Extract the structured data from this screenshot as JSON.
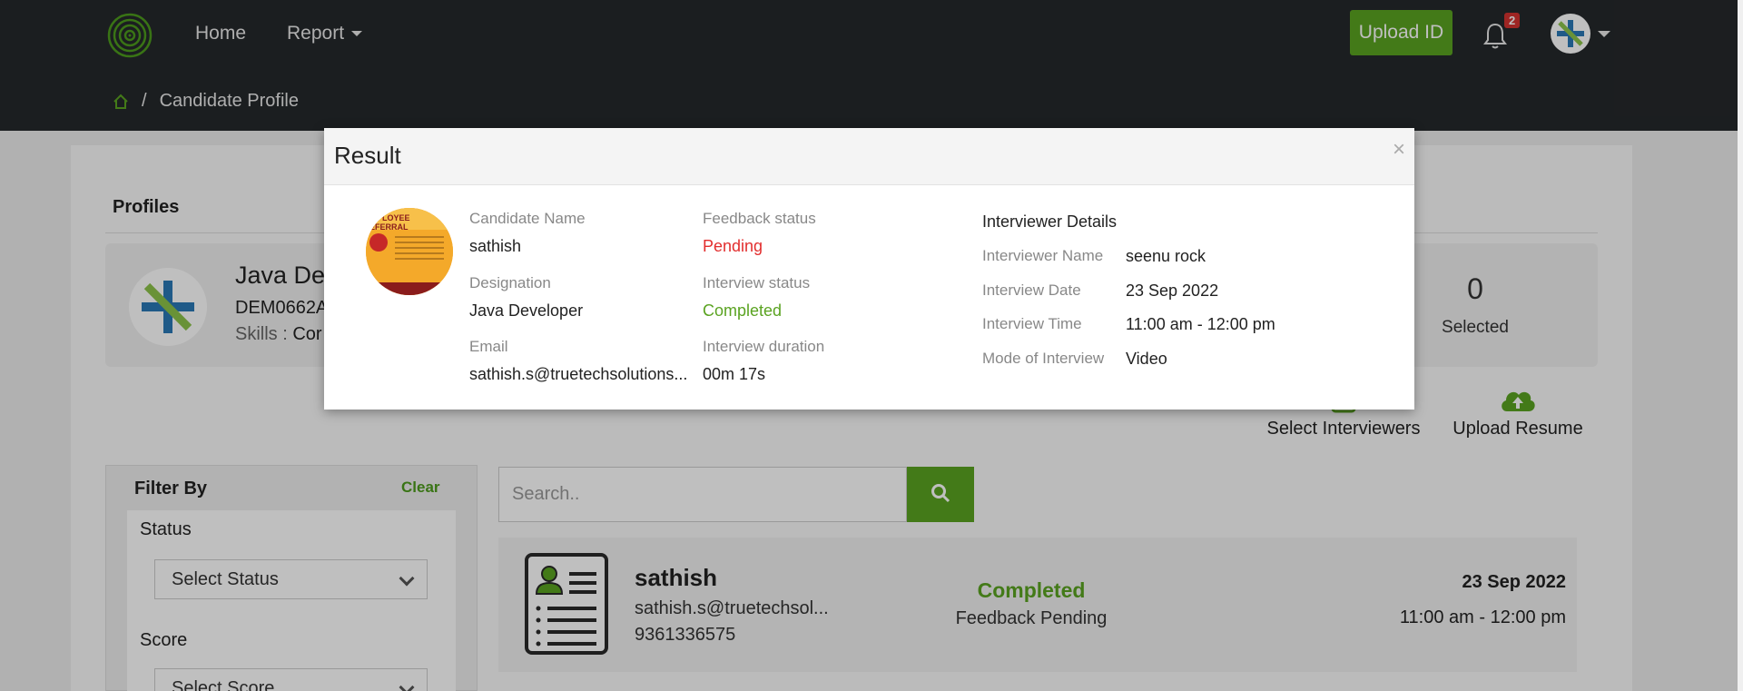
{
  "nav": {
    "home": "Home",
    "report": "Report",
    "upload_id": "Upload ID",
    "notification_count": "2"
  },
  "breadcrumb": {
    "current": "Candidate Profile",
    "separator": "/"
  },
  "profiles": {
    "title": "Profiles",
    "job_title": "Java Dev",
    "job_code": "DEM0662A",
    "skills_label": "Skills :",
    "skills_value": "Cor",
    "selected_count": "0",
    "selected_label": "Selected"
  },
  "actions": {
    "select_interviewers": "Select Interviewers",
    "upload_resume": "Upload Resume"
  },
  "filter": {
    "title": "Filter By",
    "clear": "Clear",
    "status_label": "Status",
    "status_value": "Select Status",
    "score_label": "Score",
    "score_value": "Select Score"
  },
  "search": {
    "placeholder": "Search.."
  },
  "candidate_card": {
    "name": "sathish",
    "email": "sathish.s@truetechsol...",
    "phone": "9361336575",
    "status": "Completed",
    "feedback": "Feedback Pending",
    "date": "23 Sep 2022",
    "time": "11:00 am - 12:00 pm"
  },
  "modal": {
    "title": "Result",
    "close": "×",
    "candidate_name_label": "Candidate Name",
    "candidate_name": "sathish",
    "designation_label": "Designation",
    "designation": "Java Developer",
    "email_label": "Email",
    "email": "sathish.s@truetechsolutions...",
    "feedback_status_label": "Feedback status",
    "feedback_status": "Pending",
    "interview_status_label": "Interview status",
    "interview_status": "Completed",
    "interview_duration_label": "Interview duration",
    "interview_duration": "00m 17s",
    "interviewer_details": "Interviewer Details",
    "interviewer_name_label": "Interviewer Name",
    "interviewer_name": "seenu rock",
    "interview_date_label": "Interview Date",
    "interview_date": "23 Sep 2022",
    "interview_time_label": "Interview Time",
    "interview_time": "11:00 am - 12:00 pm",
    "mode_label": "Mode of Interview",
    "mode": "Video"
  },
  "colors": {
    "navbar": "#25282b",
    "accent_green": "#5aa321",
    "pending_red": "#e22e2e",
    "badge_red": "#d3322f"
  },
  "icons": [
    "app-logo-icon",
    "home-icon",
    "bell-icon",
    "search-icon",
    "cloud-upload-icon",
    "user-resume-icon",
    "chevron-down-icon",
    "close-icon"
  ]
}
